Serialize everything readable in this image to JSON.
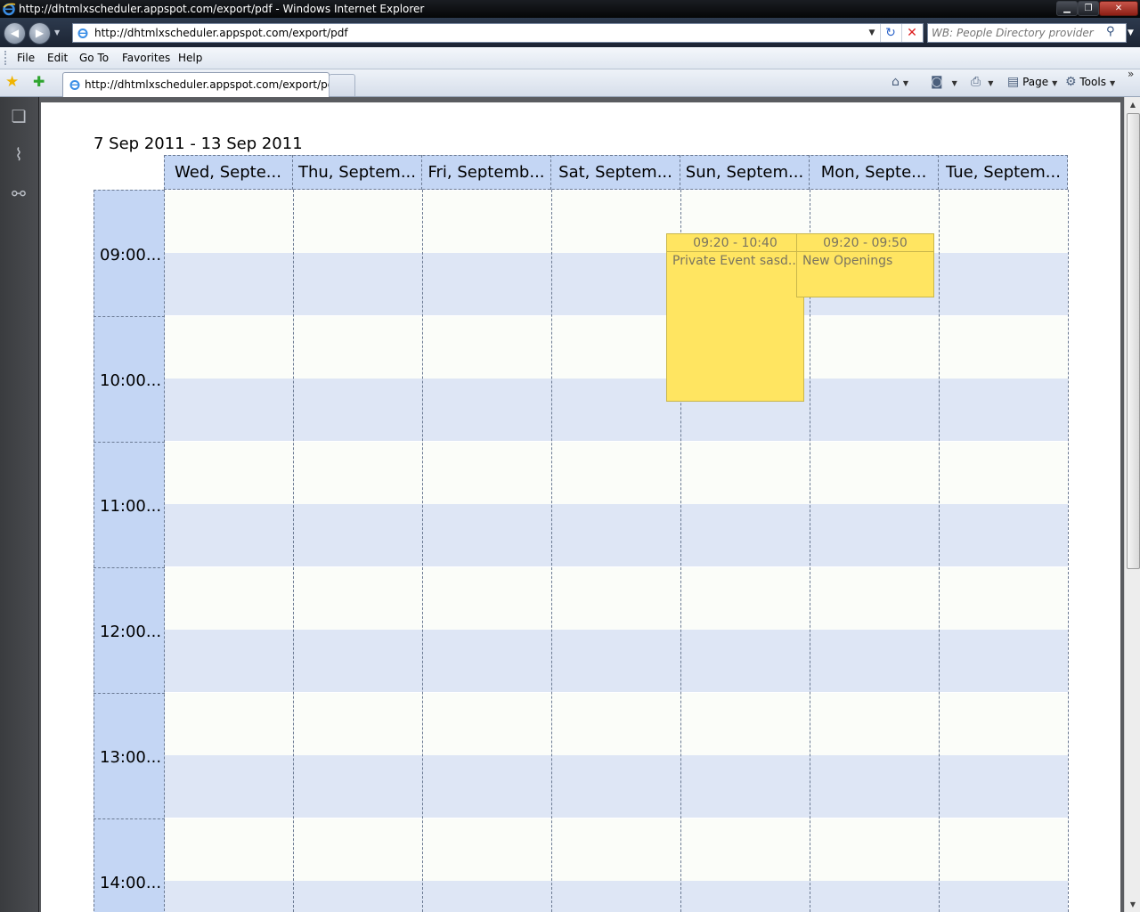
{
  "window": {
    "title": "http://dhtmlxscheduler.appspot.com/export/pdf - Windows Internet Explorer",
    "minimize": "▁",
    "maximize": "❐",
    "close": "✕"
  },
  "address": {
    "url": "http://dhtmlxscheduler.appspot.com/export/pdf",
    "back": "◀",
    "forward": "▶",
    "dropdown": "▼",
    "refresh": "↻",
    "stop": "✕"
  },
  "search": {
    "placeholder": "WB: People Directory provider",
    "icon": "search-icon"
  },
  "menu": {
    "items": [
      "File",
      "Edit",
      "Go To",
      "Favorites",
      "Help"
    ]
  },
  "tabs": {
    "active_label": "http://dhtmlxscheduler.appspot.com/export/pdf"
  },
  "toolbar": {
    "home": "⌂",
    "feeds": "◙",
    "print": "⎙",
    "page_label": "Page",
    "tools_label": "Tools",
    "chevron": "»"
  },
  "scheduler": {
    "date_range": "7 Sep 2011 - 13 Sep 2011",
    "days": [
      "Wed, Septe...",
      "Thu, Septem...",
      "Fri, Septemb...",
      "Sat, Septem...",
      "Sun, Septem...",
      "Mon, Septe...",
      "Tue, Septem..."
    ],
    "times": [
      "09:00...",
      "10:00...",
      "11:00...",
      "12:00...",
      "13:00...",
      "14:00..."
    ],
    "events": [
      {
        "time": "09:20 - 10:40",
        "text": "Private Event sasd...",
        "day_index": 4
      },
      {
        "time": "09:20 - 09:50",
        "text": "New Openings",
        "day_index": 5
      }
    ]
  },
  "colors": {
    "header_blue": "#c4d6f4",
    "row_blue": "#dee6f5",
    "row_light": "#fbfdf9",
    "event_yellow": "#ffe561"
  }
}
